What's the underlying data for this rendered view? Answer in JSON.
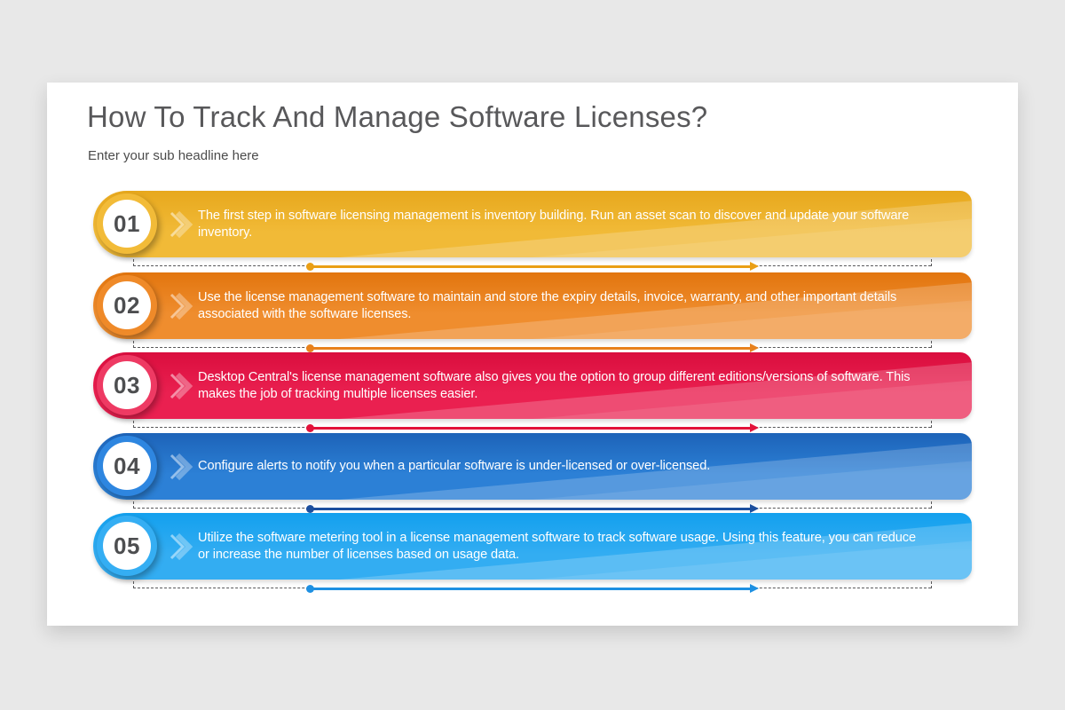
{
  "slide": {
    "title": "How To Track And Manage Software Licenses?",
    "subtitle": "Enter your sub headline here"
  },
  "steps": [
    {
      "number": "01",
      "text": "The first step in software licensing management is inventory building. Run an asset scan to discover and update your software inventory.",
      "colors": {
        "top": "#e7a81d",
        "main": "#f1ba37",
        "ring": "#f2bb38",
        "connector": "#ea9f15"
      }
    },
    {
      "number": "02",
      "text": "Use the license management software to maintain and store the expiry details, invoice, warranty, and other important details associated with the software licenses.",
      "colors": {
        "top": "#e2750e",
        "main": "#ef8d2e",
        "ring": "#ef8a29",
        "connector": "#e8811c"
      }
    },
    {
      "number": "03",
      "text": "Desktop Central's license management software also gives you the option to group different editions/versions of software. This makes the job of tracking multiple licenses easier.",
      "colors": {
        "top": "#da0e3e",
        "main": "#ea2050",
        "ring": "#ee3a63",
        "connector": "#e3123a"
      }
    },
    {
      "number": "04",
      "text": "Configure alerts to notify you when a particular software is under-licensed or over-licensed.",
      "colors": {
        "top": "#1d63b8",
        "main": "#2c80d6",
        "ring": "#2e86e0",
        "connector": "#1d4f9e"
      }
    },
    {
      "number": "05",
      "text": "Utilize the software metering tool in a license management software to track software usage. Using this feature, you can reduce or increase the number of licenses based on usage data.",
      "colors": {
        "top": "#13a0ee",
        "main": "#33adf2",
        "ring": "#35aef3",
        "connector": "#1e90e2"
      }
    }
  ]
}
